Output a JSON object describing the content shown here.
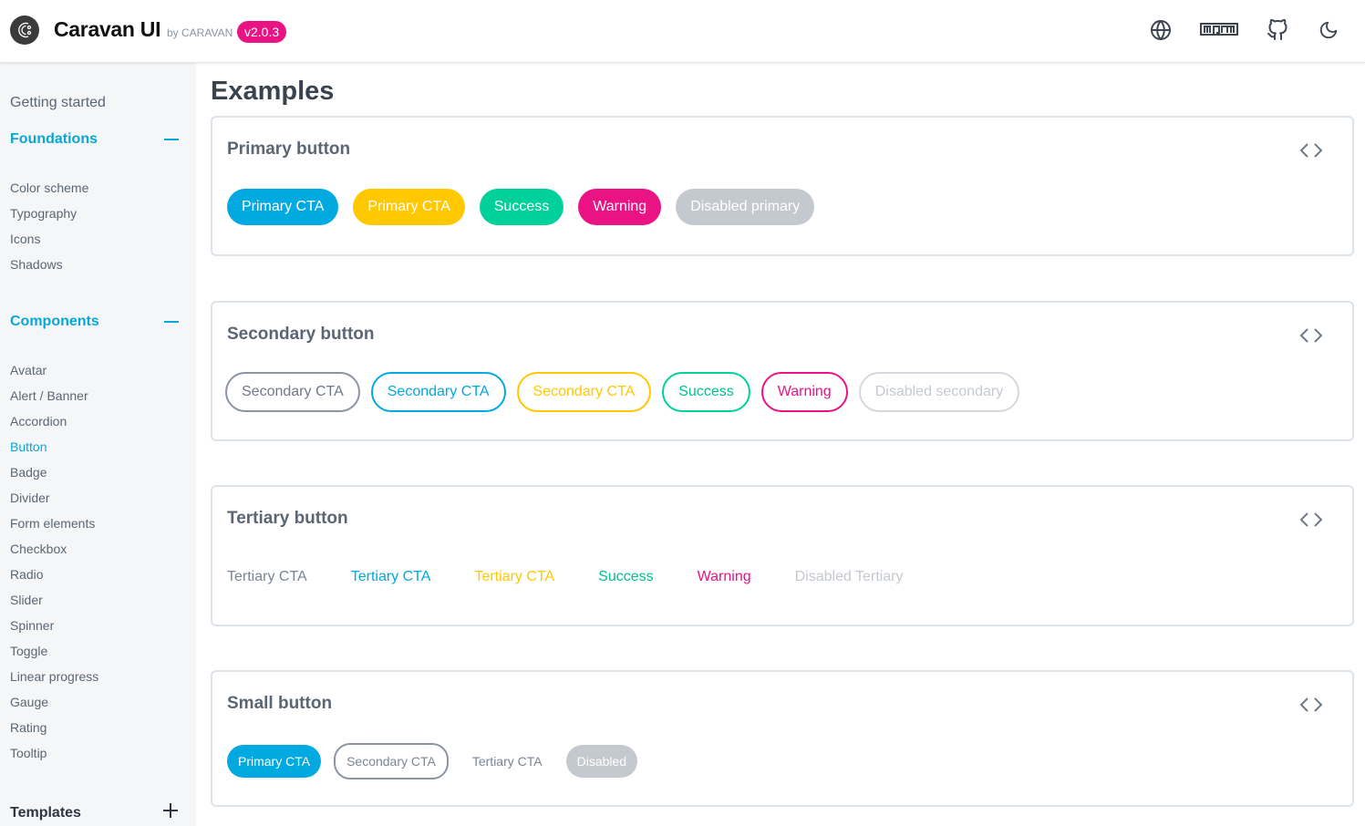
{
  "header": {
    "brand": "Caravan UI",
    "by": "by CARAVAN",
    "version": "v2.0.3",
    "icons": [
      "globe-icon",
      "npm-icon",
      "github-icon",
      "moon-icon"
    ]
  },
  "sidebar": {
    "getting_started": "Getting started",
    "foundations": {
      "label": "Foundations",
      "items": [
        "Color scheme",
        "Typography",
        "Icons",
        "Shadows"
      ]
    },
    "components": {
      "label": "Components",
      "items": [
        "Avatar",
        "Alert / Banner",
        "Accordion",
        "Button",
        "Badge",
        "Divider",
        "Form elements",
        "Checkbox",
        "Radio",
        "Slider",
        "Spinner",
        "Toggle",
        "Linear progress",
        "Gauge",
        "Rating",
        "Tooltip"
      ],
      "active": "Button"
    },
    "templates": {
      "label": "Templates"
    }
  },
  "main": {
    "title": "Examples",
    "cards": [
      {
        "title": "Primary button",
        "buttons": [
          {
            "label": "Primary CTA",
            "color": "#00a9e0"
          },
          {
            "label": "Primary CTA",
            "color": "#ffc800"
          },
          {
            "label": "Success",
            "color": "#00d19a"
          },
          {
            "label": "Warning",
            "color": "#e91384"
          },
          {
            "label": "Disabled primary",
            "color": "#c4c9cf"
          }
        ]
      },
      {
        "title": "Secondary button",
        "buttons": [
          {
            "label": "Secondary CTA",
            "color": "#8a94a3",
            "text": "#6f7a88"
          },
          {
            "label": "Secondary CTA",
            "color": "#00a9e0",
            "text": "#00a9e0"
          },
          {
            "label": "Secondary CTA",
            "color": "#ffc800",
            "text": "#ffc800"
          },
          {
            "label": "Success",
            "color": "#00d19a",
            "text": "#00c291"
          },
          {
            "label": "Warning",
            "color": "#e91384",
            "text": "#e91384"
          },
          {
            "label": "Disabled secondary",
            "color": "#d4d8dd",
            "text": "#c4c9cf"
          }
        ]
      },
      {
        "title": "Tertiary button",
        "buttons": [
          {
            "label": "Tertiary CTA",
            "text": "#7a8594"
          },
          {
            "label": "Tertiary CTA",
            "text": "#00a9e0"
          },
          {
            "label": "Tertiary CTA",
            "text": "#ffc800"
          },
          {
            "label": "Success",
            "text": "#00c291"
          },
          {
            "label": "Warning",
            "text": "#e91384"
          },
          {
            "label": "Disabled Tertiary",
            "text": "#c4c9cf"
          }
        ]
      },
      {
        "title": "Small button",
        "buttons": [
          {
            "label": "Primary CTA",
            "kind": "primary",
            "color": "#00a9e0"
          },
          {
            "label": "Secondary CTA",
            "kind": "secondary",
            "color": "#8a94a3",
            "text": "#7a8594"
          },
          {
            "label": "Tertiary CTA",
            "kind": "tertiary",
            "text": "#7a8594"
          },
          {
            "label": "Disabled",
            "kind": "disabled",
            "color": "#c4c9cf"
          }
        ]
      }
    ]
  },
  "colors": {
    "accent": "#06a8d9",
    "brand_pink": "#e91384"
  }
}
